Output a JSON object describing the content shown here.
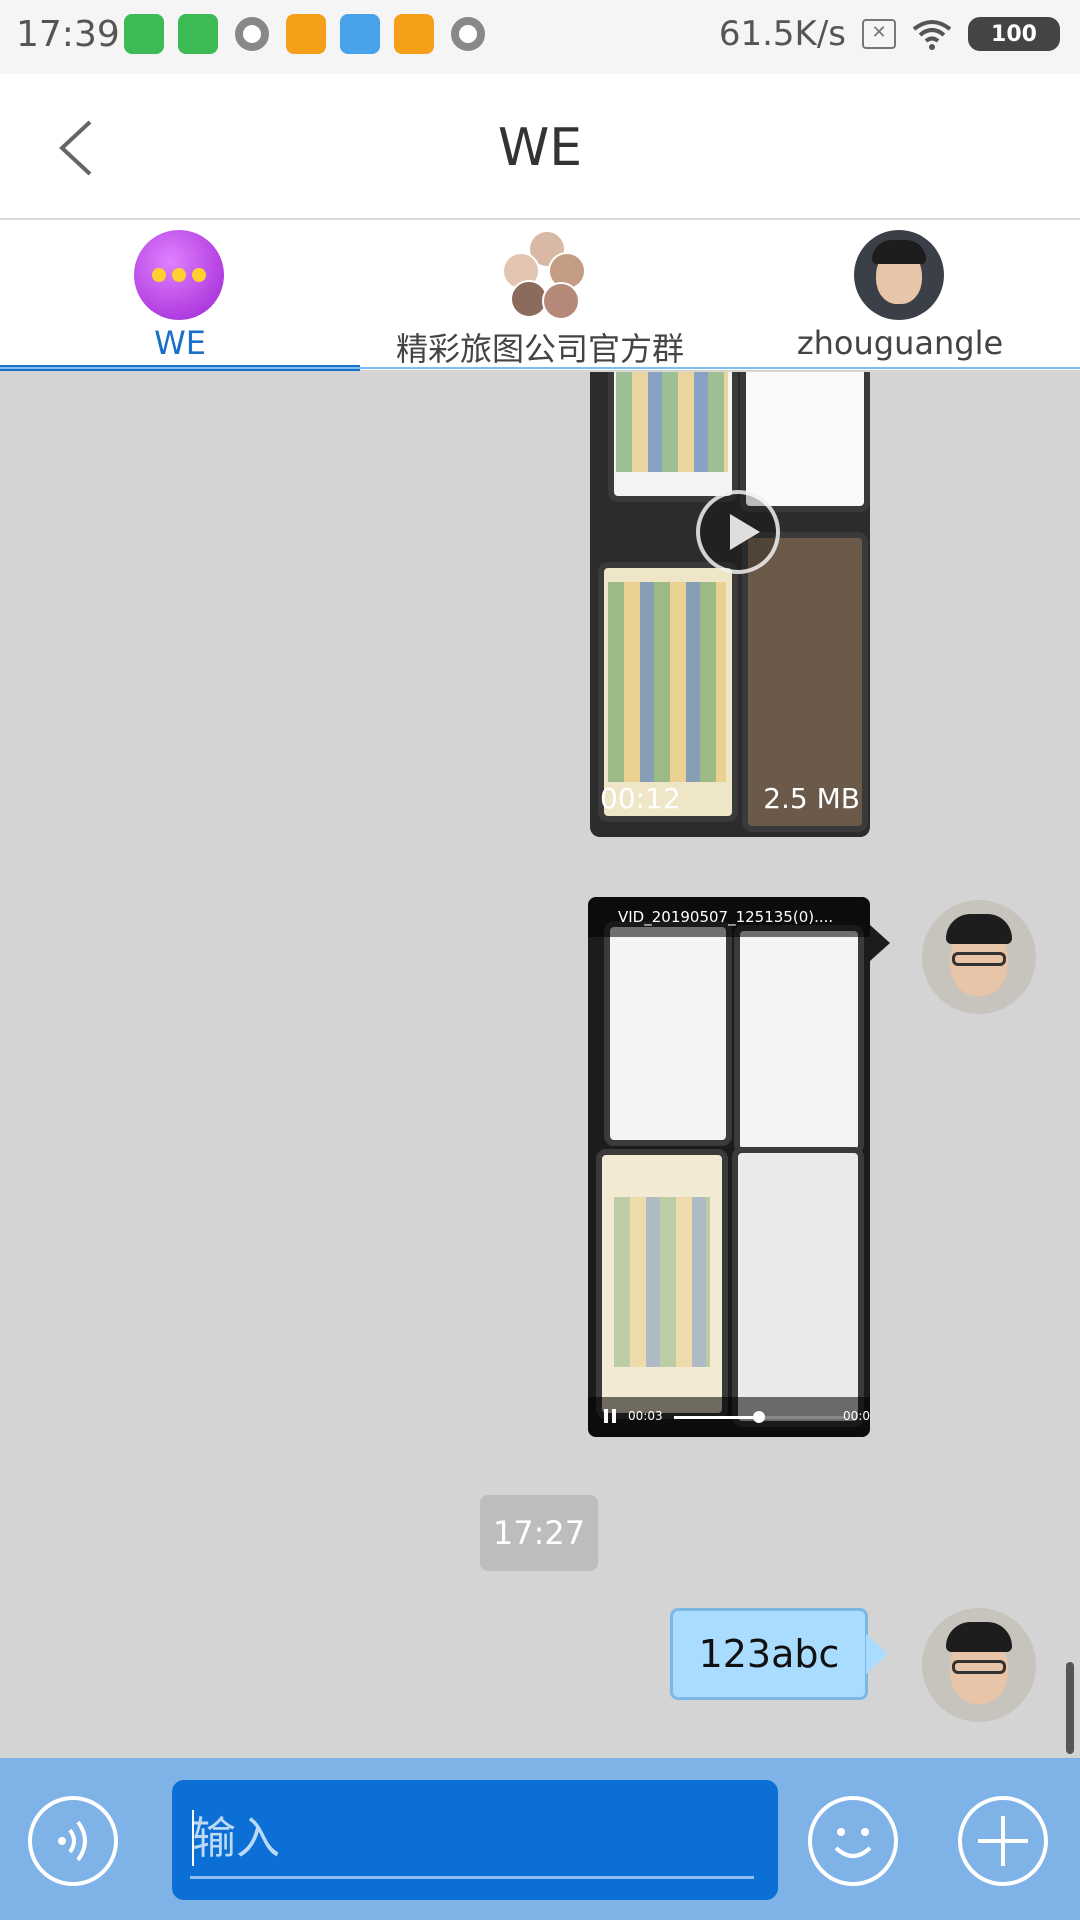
{
  "status_bar": {
    "time": "17:39",
    "net_speed": "61.5K/s",
    "battery": "100",
    "sim_icon_text": "✕"
  },
  "header": {
    "title": "WE",
    "back_icon": "chevron-left-icon"
  },
  "tabs": [
    {
      "label": "WE",
      "active": true
    },
    {
      "label": "精彩旅图公司官方群",
      "active": false
    },
    {
      "label": "zhouguangle",
      "active": false
    }
  ],
  "messages": {
    "video_1": {
      "duration": "00:12",
      "size": "2.5 MB"
    },
    "video_2": {
      "filename": "VID_20190507_125135(0)....",
      "current_time": "00:03",
      "end_time": "00:0",
      "progress": 0.5
    },
    "timestamp": "17:27",
    "text_message": "123abc"
  },
  "input_bar": {
    "placeholder": "输入",
    "voice_icon": "voice-icon",
    "emoji_icon": "emoji-icon",
    "plus_icon": "plus-icon"
  },
  "colors": {
    "accent": "#1a6fc9",
    "bubble": "#a9dcff",
    "input_bar": "#7fb3e8",
    "input_box": "#0b6fd6"
  }
}
